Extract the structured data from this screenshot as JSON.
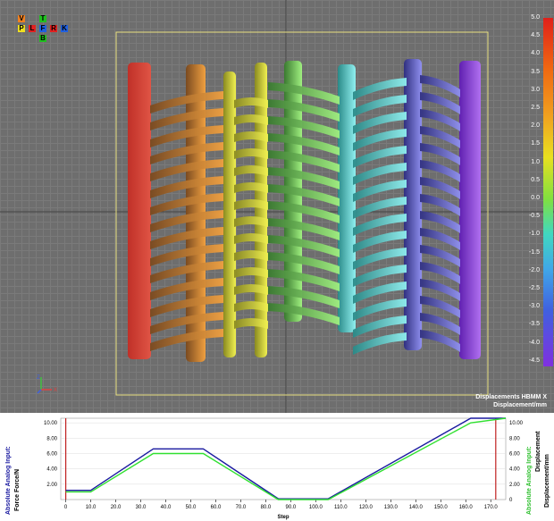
{
  "view_cube": {
    "top": "T",
    "left_v": "V",
    "p": "P",
    "l": "L",
    "f": "F",
    "r": "R",
    "k": "K",
    "bottom": "B"
  },
  "legend": {
    "title_line1": "Displacements HBMM X",
    "title_line2": "Displacement/mm",
    "ticks": [
      "5.0",
      "4.5",
      "4.0",
      "3.5",
      "3.0",
      "2.5",
      "2.0",
      "1.5",
      "1.0",
      "0.5",
      "0.0",
      "-0.5",
      "-1.0",
      "-1.5",
      "-2.0",
      "-2.5",
      "-3.0",
      "-3.5",
      "-4.0",
      "-4.5"
    ]
  },
  "axis_triad": {
    "z": "Z",
    "x": "X"
  },
  "chart_data": {
    "type": "line",
    "xlabel": "Step",
    "ylabel_left_line1": "Absolute Analog Input:",
    "ylabel_left_line2": "Force",
    "ylabel_left_line3": "Force/N",
    "ylabel_right_line1": "Absolute Analog Input:",
    "ylabel_right_line2": "Displacement",
    "ylabel_right_line3": "Displacement/mm",
    "x_ticks": [
      "0",
      "10.0",
      "20.0",
      "30.0",
      "40.0",
      "50.0",
      "60.0",
      "70.0",
      "80.0",
      "90.0",
      "100.0",
      "110.0",
      "120.0",
      "130.0",
      "140.0",
      "150.0",
      "160.0",
      "170.0"
    ],
    "y_ticks_left": [
      "2.00",
      "4.00",
      "6.00",
      "8.00",
      "10.00"
    ],
    "y_ticks_right": [
      "0",
      "2.00",
      "4.00",
      "6.00",
      "8.00",
      "10.00"
    ],
    "xlim": [
      -2,
      176
    ],
    "ylim": [
      0,
      10.6
    ],
    "series": [
      {
        "name": "Force",
        "color": "#1a1aa0",
        "x": [
          0,
          10,
          35,
          55,
          85,
          105,
          162,
          176
        ],
        "y": [
          1.2,
          1.2,
          6.6,
          6.6,
          0.1,
          0.1,
          10.6,
          10.6
        ]
      },
      {
        "name": "Displacement",
        "color": "#30e030",
        "x": [
          0,
          10,
          35,
          55,
          85,
          105,
          162,
          176
        ],
        "y": [
          1.0,
          1.0,
          6.0,
          6.0,
          0.0,
          0.0,
          10.0,
          10.6
        ]
      }
    ],
    "markers": [
      {
        "x": 0,
        "color": "#c02020"
      },
      {
        "x": 172,
        "color": "#c02020"
      }
    ]
  }
}
